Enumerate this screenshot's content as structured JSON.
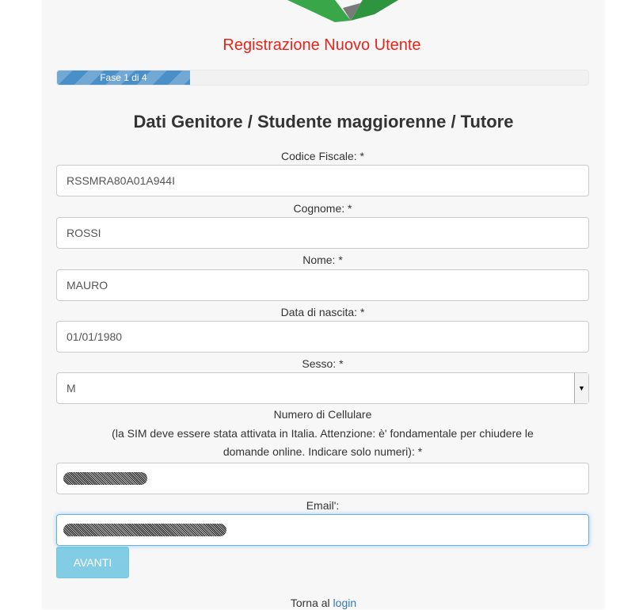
{
  "header": {
    "title": "Registrazione Nuovo Utente"
  },
  "progress": {
    "label": "Fase 1 di 4",
    "fraction": 0.25,
    "color": "#4a90c8"
  },
  "section_heading": "Dati Genitore / Studente maggiorenne / Tutore",
  "fields": {
    "codice_fiscale": {
      "label": "Codice Fiscale: *",
      "value": "RSSMRA80A01A944I"
    },
    "cognome": {
      "label": "Cognome: *",
      "value": "ROSSI"
    },
    "nome": {
      "label": "Nome: *",
      "value": "MAURO"
    },
    "data_nascita": {
      "label": "Data di nascita: *",
      "value": "01/01/1980"
    },
    "sesso": {
      "label": "Sesso: *",
      "value": "M"
    },
    "cellulare": {
      "label_line1": "Numero di Cellulare",
      "label_line2": "(la SIM deve essere stata attivata in Italia. Attenzione: è' fondamentale per chiudere le",
      "label_line3": "domande online. Indicare solo numeri): *",
      "value": ""
    },
    "email": {
      "label": "Email':",
      "value": ""
    }
  },
  "buttons": {
    "next_label": "AVANTI",
    "next_color": "#5bc0de"
  },
  "footer": {
    "text": "Torna al",
    "link": "login"
  },
  "colors": {
    "title": "#e8251b",
    "link": "#337ab7",
    "focus": "#66afe9"
  }
}
